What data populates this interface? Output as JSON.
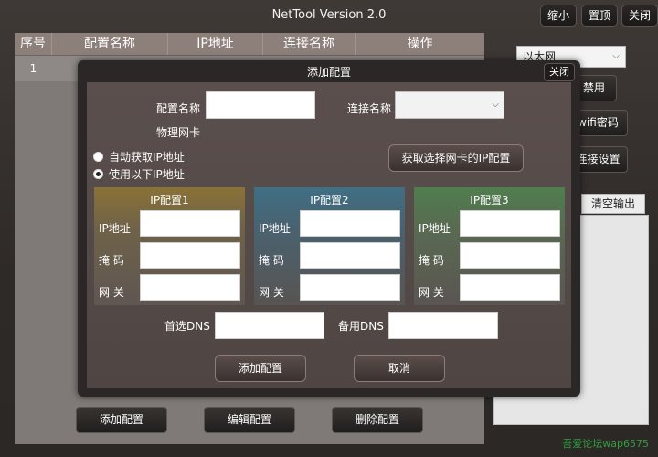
{
  "window": {
    "title": "NetTool Version 2.0",
    "minimize_label": "缩小",
    "topmost_label": "置顶",
    "close_label": "关闭"
  },
  "table": {
    "columns": [
      "序号",
      "配置名称",
      "IP地址",
      "连接名称",
      "操作"
    ],
    "rows": [
      [
        "1",
        "",
        "",
        "",
        ""
      ]
    ]
  },
  "bottom_buttons": {
    "add": "添加配置",
    "edit": "编辑配置",
    "delete": "删除配置"
  },
  "right_panel": {
    "adapter_select": "以太网",
    "disable_button": "禁用",
    "wifi_button": "wifi密码",
    "connection_button": "连接设置",
    "clear_output_button": "清空输出"
  },
  "dialog": {
    "title": "添加配置",
    "close_label": "关闭",
    "config_name_label": "配置名称",
    "config_name_value": "",
    "connection_name_label": "连接名称",
    "connection_name_value": "",
    "physical_nic_label": "物理网卡",
    "auto_ip_label": "自动获取IP地址",
    "manual_ip_label": "使用以下IP地址",
    "get_ip_button": "获取选择网卡的IP配置",
    "groups": [
      {
        "title": "IP配置1",
        "ip_label": "IP地址",
        "mask_label": "掩 码",
        "gateway_label": "网 关"
      },
      {
        "title": "IP配置2",
        "ip_label": "IP地址",
        "mask_label": "掩 码",
        "gateway_label": "网 关"
      },
      {
        "title": "IP配置3",
        "ip_label": "IP地址",
        "mask_label": "掩 码",
        "gateway_label": "网 关"
      }
    ],
    "dns1_label": "首选DNS",
    "dns2_label": "备用DNS",
    "add_button": "添加配置",
    "cancel_button": "取消"
  },
  "watermark": "吾爱论坛wap6575"
}
